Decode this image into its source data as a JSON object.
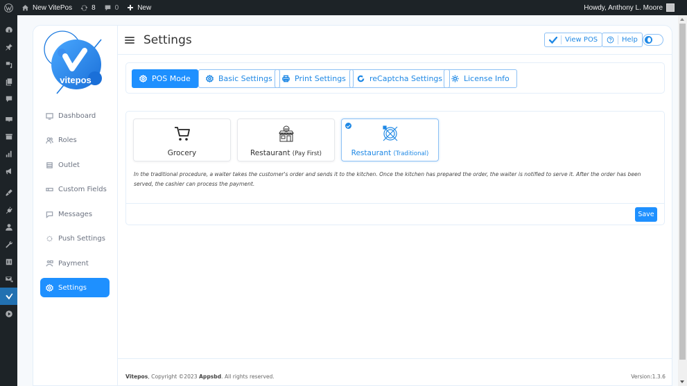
{
  "adminbar": {
    "site_name": "New VitePos",
    "updates_count": "8",
    "comments_count": "0",
    "new_label": "New",
    "greeting": "Howdy, Anthony L. Moore"
  },
  "admin_menu_icons": [
    "dashboard-icon",
    "pin-icon",
    "media-icon",
    "pages-icon",
    "comments-icon",
    "woocommerce-icon",
    "products-icon",
    "analytics-icon",
    "marketing-icon",
    "appearance-icon",
    "plugins-icon",
    "users-icon",
    "tools-icon",
    "settings-icon",
    "mail-icon",
    "vitepos-icon",
    "play-icon"
  ],
  "app": {
    "logo_text": "vitepos",
    "nav": [
      {
        "label": "Dashboard",
        "icon": "dashboard-icon"
      },
      {
        "label": "Roles",
        "icon": "users-icon"
      },
      {
        "label": "Outlet",
        "icon": "store-icon"
      },
      {
        "label": "Custom Fields",
        "icon": "field-icon"
      },
      {
        "label": "Messages",
        "icon": "message-icon"
      },
      {
        "label": "Push Settings",
        "icon": "push-icon"
      },
      {
        "label": "Payment",
        "icon": "payment-icon"
      },
      {
        "label": "Settings",
        "icon": "gear-icon",
        "active": true
      }
    ],
    "header": {
      "title": "Settings",
      "view_pos_label": "View POS",
      "help_label": "Help"
    },
    "tabs": [
      {
        "label": "POS Mode",
        "icon": "gear-icon",
        "active": true
      },
      {
        "label": "Basic Settings",
        "icon": "gear-icon"
      },
      {
        "label": "Print Settings",
        "icon": "printer-icon"
      },
      {
        "label": "reCaptcha  Settings",
        "icon": "recaptcha-icon"
      },
      {
        "label": "License Info",
        "icon": "sun-icon"
      }
    ],
    "modes": [
      {
        "label": "Grocery",
        "sub": "",
        "icon": "cart-icon",
        "selected": false
      },
      {
        "label": "Restaurant",
        "sub": "(Pay First)",
        "icon": "restaurant-icon",
        "selected": false
      },
      {
        "label": "Restaurant",
        "sub": "(Traditional)",
        "icon": "dining-icon",
        "selected": true
      }
    ],
    "mode_description": "In the traditional procedure, a waiter takes the customer's order and sends it to the kitchen. Once the kitchen has prepared the order, the waiter is notified to serve it. After the order has been served, the cashier can process the payment.",
    "save_label": "Save",
    "footer": {
      "brand": "Vitepos",
      "copyright_mid": ", Copyright ©2023 ",
      "company": "Appsbd",
      "copyright_end": ". All rights reserved.",
      "version": "Version:1.3.6"
    }
  },
  "colors": {
    "primary": "#1e90ff",
    "wp_dark": "#1d2327",
    "wp_active": "#2271b1"
  }
}
